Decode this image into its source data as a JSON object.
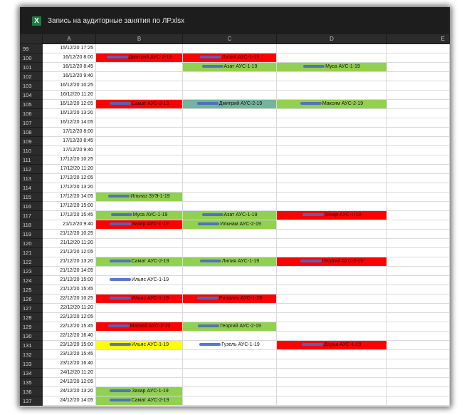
{
  "window": {
    "title": "Запись на аудиторные занятия по ЛР.xlsx",
    "app_icon": "excel-icon",
    "app_icon_glyph": "X"
  },
  "columns": [
    "A",
    "B",
    "C",
    "D",
    "E"
  ],
  "colors": {
    "red": "#ff0000",
    "green": "#92d050",
    "teal": "#76b39d",
    "yellow": "#ffff00",
    "white": "#ffffff"
  },
  "rows": [
    {
      "num": "99",
      "a": "15/12/20 17:25"
    },
    {
      "num": "100",
      "a": "16/12/20 8:00",
      "b": {
        "text": "Дмитрий АУС-2-19",
        "color": "red"
      },
      "c": {
        "text": "Лилия АУС-1-19",
        "color": "red"
      }
    },
    {
      "num": "101",
      "a": "16/12/20 8:45",
      "c": {
        "text": "Азат АУС-1-19",
        "color": "green"
      },
      "d": {
        "text": "Муса АУС-1-19",
        "color": "green"
      }
    },
    {
      "num": "102",
      "a": "16/12/20 9:40"
    },
    {
      "num": "103",
      "a": "16/12/20 10:25"
    },
    {
      "num": "104",
      "a": "16/12/20 11:20"
    },
    {
      "num": "105",
      "a": "16/12/20 12:05",
      "b": {
        "text": "Самат АУС-2-19",
        "color": "red"
      },
      "c": {
        "text": "Дмитрий АУС-2-19",
        "color": "teal"
      },
      "d": {
        "text": "Максим АУС-2-19",
        "color": "green"
      }
    },
    {
      "num": "106",
      "a": "16/12/20 13:20"
    },
    {
      "num": "107",
      "a": "16/12/20 14:05"
    },
    {
      "num": "108",
      "a": "17/12/20 8:00"
    },
    {
      "num": "109",
      "a": "17/12/20 8:45"
    },
    {
      "num": "110",
      "a": "17/12/20 9:40"
    },
    {
      "num": "111",
      "a": "17/12/20 10:25"
    },
    {
      "num": "112",
      "a": "17/12/20 11:20"
    },
    {
      "num": "113",
      "a": "17/12/20 12:05"
    },
    {
      "num": "114",
      "a": "17/12/20 13:20"
    },
    {
      "num": "115",
      "a": "17/12/20 14:05",
      "b": {
        "text": "Ильназ ЗУЭ-1-19",
        "color": "green"
      }
    },
    {
      "num": "116",
      "a": "17/12/20 15:00"
    },
    {
      "num": "117",
      "a": "17/12/20 15:45",
      "b": {
        "text": "Муса АУС-1-19",
        "color": "green"
      },
      "c": {
        "text": "Азат АУС-1-19",
        "color": "green"
      },
      "d": {
        "text": "Захар АУС-1-19",
        "color": "red"
      }
    },
    {
      "num": "118",
      "a": "21/12/20 9:40",
      "b": {
        "text": "Захар АУС-1-19",
        "color": "red"
      },
      "c": {
        "text": "Ильнам АУС-2-19",
        "color": "green"
      }
    },
    {
      "num": "119",
      "a": "21/12/20 10:25"
    },
    {
      "num": "120",
      "a": "21/12/20 11:20"
    },
    {
      "num": "121",
      "a": "21/12/20 12:05"
    },
    {
      "num": "122",
      "a": "21/12/20 13:20",
      "b": {
        "text": "Самат АУС-2-19",
        "color": "green"
      },
      "c": {
        "text": "Лилия АУС-1-19",
        "color": "green"
      },
      "d": {
        "text": "Георгий АУС-2-19",
        "color": "red"
      }
    },
    {
      "num": "123",
      "a": "21/12/20 14:05"
    },
    {
      "num": "124",
      "a": "21/12/20 15:00",
      "b": {
        "text": "Ильяс АУС-1-19",
        "color": "white"
      }
    },
    {
      "num": "125",
      "a": "21/12/20 15:45"
    },
    {
      "num": "126",
      "a": "22/12/20 10:25",
      "b": {
        "text": "Ильяс АУС-1-19",
        "color": "red"
      },
      "c": {
        "text": "Ринаиль АУС-1-19",
        "color": "red"
      }
    },
    {
      "num": "127",
      "a": "22/12/20 11:20"
    },
    {
      "num": "128",
      "a": "22/12/20 12:05"
    },
    {
      "num": "129",
      "a": "22/12/20 15:45",
      "b": {
        "text": "Матвей АУС-2-19",
        "color": "red"
      },
      "c": {
        "text": "Георгий АУС-2-19",
        "color": "green"
      }
    },
    {
      "num": "130",
      "a": "22/12/20 16:40"
    },
    {
      "num": "131",
      "a": "23/12/20 15:00",
      "b": {
        "text": "Ильяс АУС-1-19",
        "color": "yellow"
      },
      "c": {
        "text": "Гузель АУС-1-19",
        "color": "white"
      },
      "d": {
        "text": "Дарья АУС-1-19",
        "color": "red"
      }
    },
    {
      "num": "132",
      "a": "23/12/20 15:45"
    },
    {
      "num": "133",
      "a": "23/12/20 16:40"
    },
    {
      "num": "134",
      "a": "24/12/20 11:20"
    },
    {
      "num": "135",
      "a": "24/12/20 12:05"
    },
    {
      "num": "136",
      "a": "24/12/20 13:20",
      "b": {
        "text": "Захар АУС-1-19",
        "color": "green"
      }
    },
    {
      "num": "137",
      "a": "24/12/20 14:05",
      "b": {
        "text": "Самат АУС-2-19",
        "color": "green"
      }
    }
  ]
}
